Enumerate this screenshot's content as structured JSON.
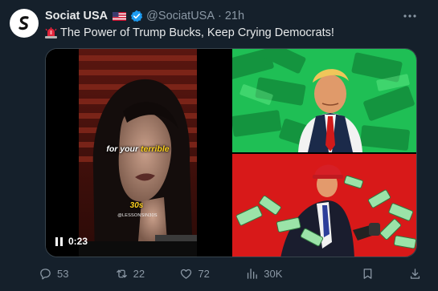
{
  "post": {
    "author_name": "Sociat USA",
    "handle": "@SociatUSA",
    "separator": "·",
    "time": "21h",
    "text": "The Power of Trump Bucks, Keep Crying Democrats!"
  },
  "video": {
    "caption_normal": "for your ",
    "caption_highlight": "terrible",
    "overlay_logo": "30s",
    "overlay_handle": "@LESSONSIN30S",
    "elapsed": "0:23",
    "state": "playing"
  },
  "actions": {
    "replies": "53",
    "reposts": "22",
    "likes": "72",
    "views": "30K"
  },
  "colors": {
    "background": "#15202b",
    "text": "#e7e9ea",
    "muted": "#8b98a5",
    "verified": "#1d9bf0",
    "money_green": "#1fbf55",
    "red_bg": "#d81919"
  }
}
